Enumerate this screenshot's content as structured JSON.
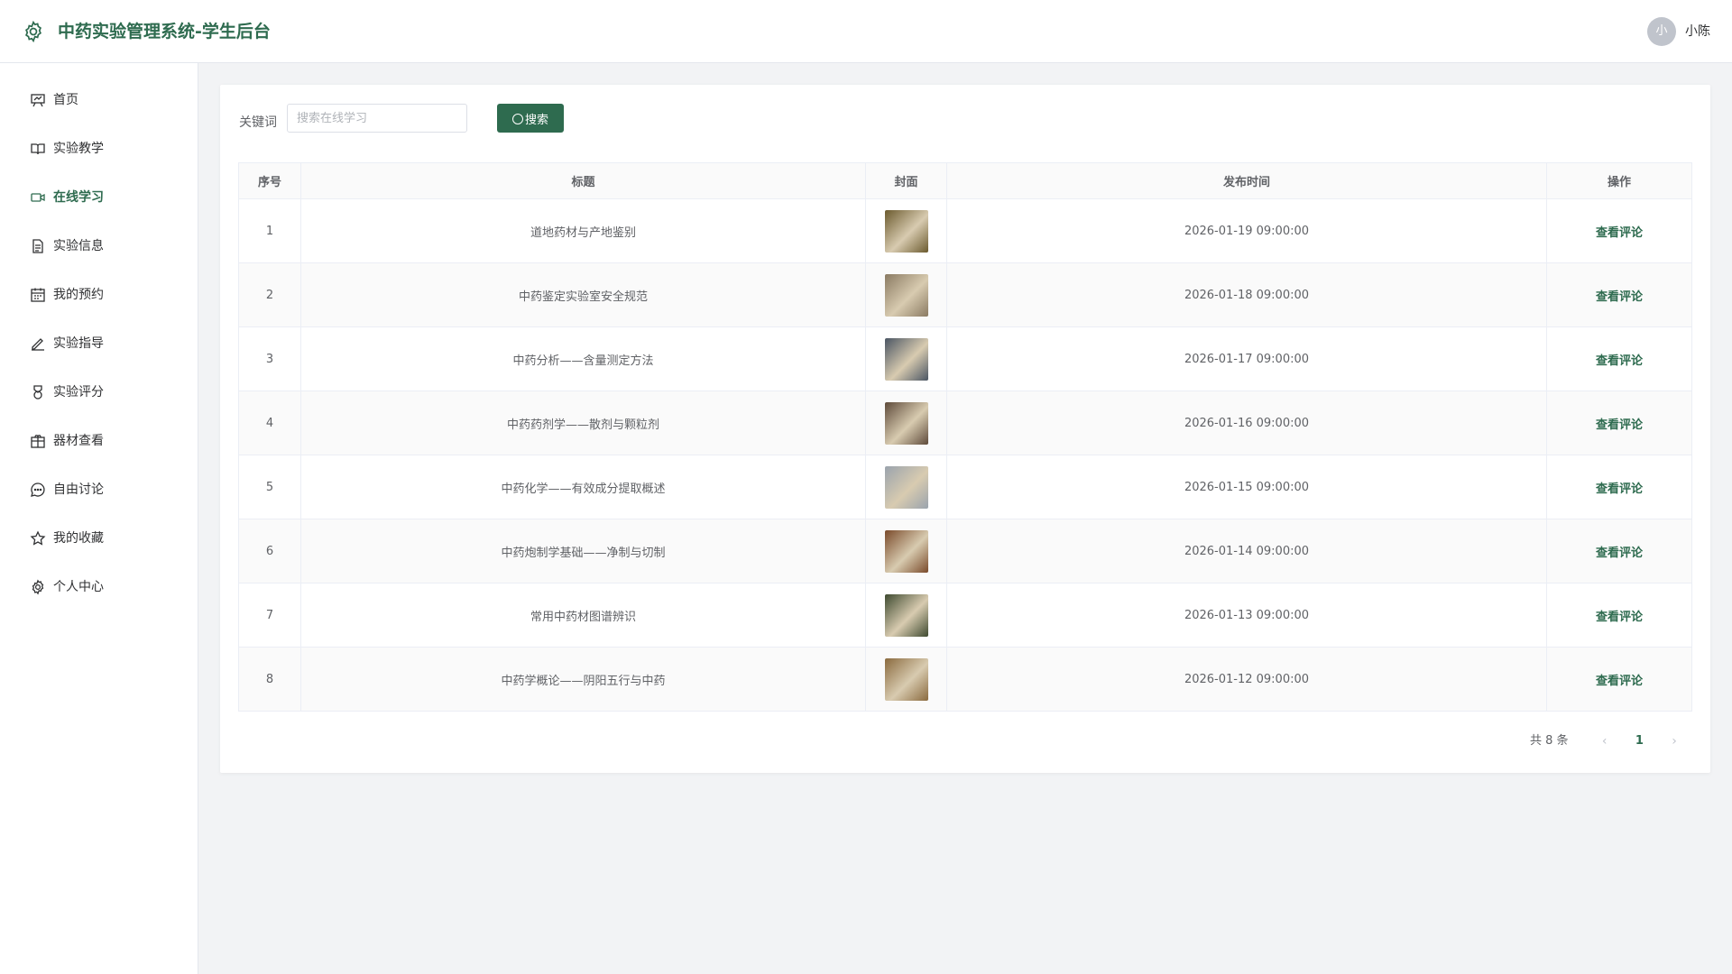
{
  "header": {
    "title": "中药实验管理系统-学生后台",
    "avatar_text": "小",
    "username": "小陈",
    "brand_color": "#2e6b4f"
  },
  "sidebar": {
    "items": [
      {
        "label": "首页",
        "icon": "presentation-board-icon"
      },
      {
        "label": "实验教学",
        "icon": "open-book-icon"
      },
      {
        "label": "在线学习",
        "icon": "video-camera-icon",
        "active": true
      },
      {
        "label": "实验信息",
        "icon": "document-icon"
      },
      {
        "label": "我的预约",
        "icon": "calendar-icon"
      },
      {
        "label": "实验指导",
        "icon": "pen-icon"
      },
      {
        "label": "实验评分",
        "icon": "medal-icon"
      },
      {
        "label": "器材查看",
        "icon": "box-icon"
      },
      {
        "label": "自由讨论",
        "icon": "chat-bubble-icon"
      },
      {
        "label": "我的收藏",
        "icon": "star-icon"
      },
      {
        "label": "个人中心",
        "icon": "gear-icon"
      }
    ]
  },
  "search": {
    "label": "关键词",
    "placeholder": "搜索在线学习",
    "button_label": "搜索"
  },
  "table": {
    "headers": [
      "序号",
      "标题",
      "封面",
      "发布时间",
      "操作"
    ],
    "action_label": "查看评论",
    "rows": [
      {
        "index": "1",
        "title": "道地药材与产地鉴别",
        "time": "2026-01-19 09:00:00",
        "cover_color": "#6b5a2e"
      },
      {
        "index": "2",
        "title": "中药鉴定实验室安全规范",
        "time": "2026-01-18 09:00:00",
        "cover_color": "#8a7a62"
      },
      {
        "index": "3",
        "title": "中药分析——含量测定方法",
        "time": "2026-01-17 09:00:00",
        "cover_color": "#4a5563"
      },
      {
        "index": "4",
        "title": "中药药剂学——散剂与颗粒剂",
        "time": "2026-01-16 09:00:00",
        "cover_color": "#5e4a3a"
      },
      {
        "index": "5",
        "title": "中药化学——有效成分提取概述",
        "time": "2026-01-15 09:00:00",
        "cover_color": "#9aa3ad"
      },
      {
        "index": "6",
        "title": "中药炮制学基础——净制与切制",
        "time": "2026-01-14 09:00:00",
        "cover_color": "#7a4a2a"
      },
      {
        "index": "7",
        "title": "常用中药材图谱辨识",
        "time": "2026-01-13 09:00:00",
        "cover_color": "#3e4a30"
      },
      {
        "index": "8",
        "title": "中药学概论——阴阳五行与中药",
        "time": "2026-01-12 09:00:00",
        "cover_color": "#8a6a3e"
      }
    ]
  },
  "pagination": {
    "total": "共 8 条",
    "current_page": "1",
    "prev": "‹",
    "next": "›"
  }
}
